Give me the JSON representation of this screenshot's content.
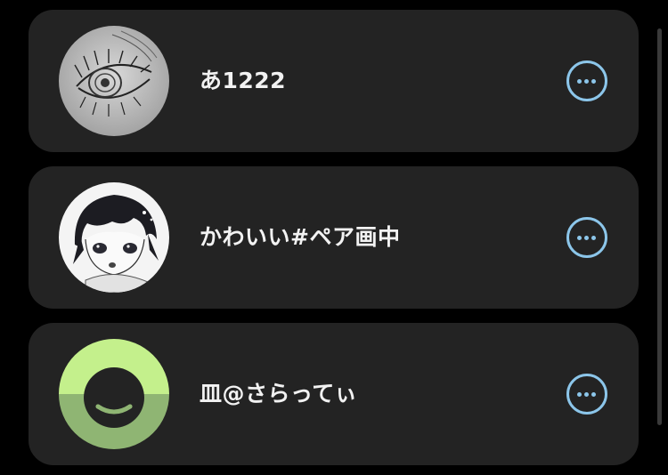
{
  "users": [
    {
      "name": "あ1222",
      "avatar": "sketch-eye-avatar",
      "more_icon": "more-horizontal-icon"
    },
    {
      "name": "かわいい#ペア画中",
      "avatar": "anime-boy-avatar",
      "more_icon": "more-horizontal-icon"
    },
    {
      "name": "皿@さらってぃ",
      "avatar": "smiley-ring-avatar",
      "more_icon": "more-horizontal-icon"
    }
  ],
  "colors": {
    "background": "#000000",
    "card": "#232323",
    "text": "#f2f2f2",
    "accent": "#8cc6ea",
    "smiley_green": "#c4f08c",
    "smiley_dark_green": "#8fb573"
  }
}
